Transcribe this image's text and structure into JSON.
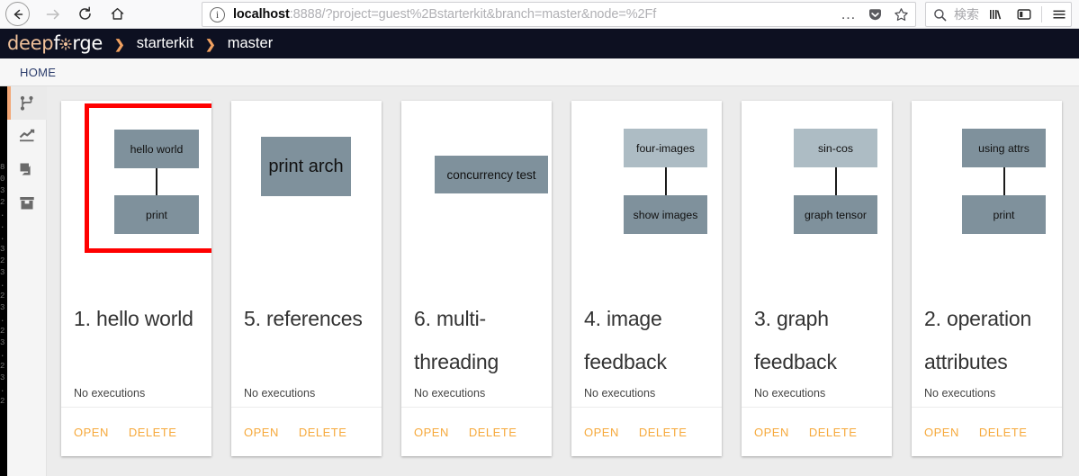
{
  "browser": {
    "back_label": "back",
    "forward_label": "forward",
    "reload_label": "reload",
    "home_label": "home",
    "url_host": "localhost",
    "url_rest": ":8888/?project=guest%2Bstarterkit&branch=master&node=%2Ff",
    "url_full": "localhost:8888/?project=guest%2Bstarterkit&branch=master&node=%2Ff",
    "info_glyph": "i",
    "page_actions_label": "…",
    "pocket_label": "Save to Pocket",
    "bookmark_label": "Bookmark this page",
    "search_placeholder": "検索",
    "library_label": "Library",
    "sidebar_label": "Sidebars",
    "menu_label": "Open menu"
  },
  "app": {
    "logo": {
      "part1": "deep",
      "part2": "f",
      "part3": "rge"
    },
    "breadcrumb_separator": "❯",
    "breadcrumb": [
      {
        "label": "starterkit"
      },
      {
        "label": "master"
      }
    ],
    "tabs": [
      {
        "label": "HOME"
      }
    ]
  },
  "sidebar": {
    "items": [
      {
        "name": "branch-icon",
        "title": "Pipelines",
        "active": true
      },
      {
        "name": "chart-icon",
        "title": "Executions",
        "active": false
      },
      {
        "name": "layers-icon",
        "title": "Artifacts",
        "active": false
      },
      {
        "name": "archive-icon",
        "title": "Resources",
        "active": false
      }
    ]
  },
  "theme": {
    "accent_orange": "#f6a93c",
    "header_navy": "#0d1021",
    "selection_red": "#ff0000",
    "node_light": "#adbcc4",
    "node_dark": "#7f919c",
    "content_bg": "#ececec"
  },
  "cards": [
    {
      "title": "1. hello world",
      "status": "No executions",
      "selected": true,
      "open_label": "OPEN",
      "delete_label": "DELETE",
      "nodes": [
        {
          "label": "hello world",
          "shade": "dark"
        },
        {
          "label": "print",
          "shade": "dark"
        }
      ]
    },
    {
      "title": "5. references",
      "status": "No executions",
      "selected": false,
      "open_label": "OPEN",
      "delete_label": "DELETE",
      "nodes": [
        {
          "label": "print arch",
          "shade": "dark"
        }
      ]
    },
    {
      "title": "6. multi-threading",
      "status": "No executions",
      "selected": false,
      "open_label": "OPEN",
      "delete_label": "DELETE",
      "nodes": [
        {
          "label": "concurrency test",
          "shade": "dark"
        }
      ]
    },
    {
      "title": "4. image feedback",
      "status": "No executions",
      "selected": false,
      "open_label": "OPEN",
      "delete_label": "DELETE",
      "nodes": [
        {
          "label": "four-images",
          "shade": "light"
        },
        {
          "label": "show images",
          "shade": "dark"
        }
      ]
    },
    {
      "title": "3. graph feedback",
      "status": "No executions",
      "selected": false,
      "open_label": "OPEN",
      "delete_label": "DELETE",
      "nodes": [
        {
          "label": "sin-cos",
          "shade": "light"
        },
        {
          "label": "graph tensor",
          "shade": "dark"
        }
      ]
    },
    {
      "title": "2. operation attributes",
      "status": "No executions",
      "selected": false,
      "open_label": "OPEN",
      "delete_label": "DELETE",
      "nodes": [
        {
          "label": "using attrs",
          "shade": "dark"
        },
        {
          "label": "print",
          "shade": "dark"
        }
      ]
    }
  ]
}
